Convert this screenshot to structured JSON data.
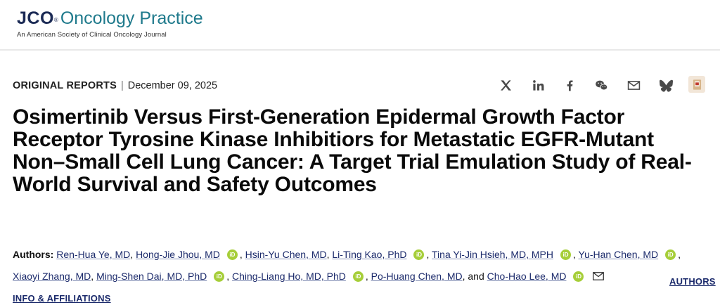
{
  "header": {
    "logo_jco": "JCO",
    "logo_reg": "®",
    "logo_name": "Oncology Practice",
    "logo_subtitle": "An American Society of Clinical Oncology Journal"
  },
  "meta": {
    "article_type": "ORIGINAL REPORTS",
    "separator": "|",
    "date": "December 09, 2025"
  },
  "share_icons": [
    "x-icon",
    "linkedin-icon",
    "facebook-icon",
    "wechat-icon",
    "email-icon",
    "bluesky-icon",
    "mendeley-icon"
  ],
  "title": "Osimertinib Versus First-Generation Epidermal Growth Factor Receptor Tyrosine Kinase Inhibitiors for Metastatic EGFR-Mutant Non–Small Cell Lung Cancer: A Target Trial Emulation Study of Real-World Survival and Safety Outcomes",
  "authors": {
    "label": "Authors:",
    "list": [
      "Ren-Hua Ye, MD",
      "Hong-Jie Jhou, MD",
      "Hsin-Yu Chen, MD",
      "Li-Ting Kao, PhD",
      "Tina Yi-Jin Hsieh, MD, MPH",
      "Yu-Han Chen, MD",
      "Xiaoyi Zhang, MD",
      "Ming-Shen Dai, MD, PhD",
      "Ching-Liang Ho, MD, PhD",
      "Po-Huang Chen, MD",
      "Cho-Hao Lee, MD"
    ],
    "comma": ",",
    "and": ", and",
    "orcid": "iD",
    "affiliations_part1": "AUTHORS",
    "affiliations_part2": "INFO & AFFILIATIONS"
  },
  "colors": {
    "brand_navy": "#1b2a55",
    "brand_teal": "#1f7a8c",
    "link": "#1b2a6b",
    "orcid_green": "#a6ce39"
  }
}
